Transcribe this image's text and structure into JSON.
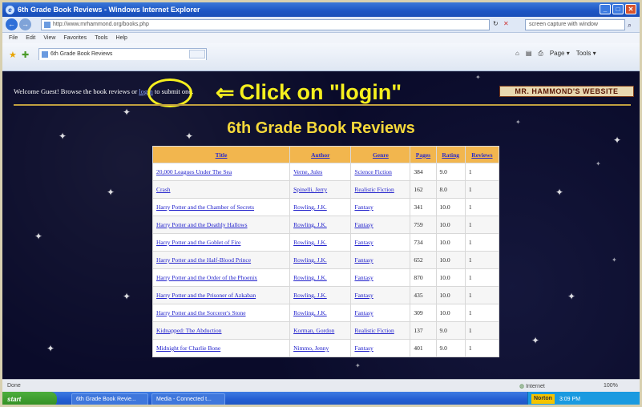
{
  "window": {
    "title": "6th Grade Book Reviews - Windows Internet Explorer",
    "min_label": "_",
    "max_label": "□",
    "close_label": "✕"
  },
  "address_bar": {
    "url": "http://www.mrhammond.org/books.php",
    "search_placeholder": "screen capture with window",
    "back_icon": "←",
    "forward_icon": "→",
    "refresh_icon": "↻",
    "stop_icon": "✕",
    "search_go_icon": "⌕"
  },
  "menu": [
    "File",
    "Edit",
    "View",
    "Favorites",
    "Tools",
    "Help"
  ],
  "tab": {
    "title": "6th Grade Book Reviews"
  },
  "command_bar": {
    "home_icon": "⌂",
    "feeds_icon": "▤",
    "print_icon": "⎙",
    "page_label": "Page ▾",
    "tools_label": "Tools ▾"
  },
  "page": {
    "welcome_prefix": "Welcome Guest! Browse the book reviews or",
    "login_link": "login",
    "welcome_suffix": "to submit one.",
    "callout_arrow": "⇐",
    "callout_text": "Click on \"login\"",
    "logo_text": "MR. HAMMOND'S WEBSITE",
    "heading": "6th Grade Book Reviews"
  },
  "table": {
    "columns": [
      "Title",
      "Author",
      "Genre",
      "Pages",
      "Rating",
      "Reviews"
    ],
    "rows": [
      [
        "20,000 Leagues Under The Sea",
        "Verne, Jules",
        "Science Fiction",
        "384",
        "9.0",
        "1"
      ],
      [
        "Crash",
        "Spinelli, Jerry",
        "Realistic Fiction",
        "162",
        "8.0",
        "1"
      ],
      [
        "Harry Potter and the Chamber of Secrets",
        "Rowling, J.K.",
        "Fantasy",
        "341",
        "10.0",
        "1"
      ],
      [
        "Harry Potter and the Deathly Hallows",
        "Rowling, J.K.",
        "Fantasy",
        "759",
        "10.0",
        "1"
      ],
      [
        "Harry Potter and the Goblet of Fire",
        "Rowling, J.K.",
        "Fantasy",
        "734",
        "10.0",
        "1"
      ],
      [
        "Harry Potter and the Half-Blood Prince",
        "Rowling, J.K.",
        "Fantasy",
        "652",
        "10.0",
        "1"
      ],
      [
        "Harry Potter and the Order of the Phoenix",
        "Rowling, J.K.",
        "Fantasy",
        "870",
        "10.0",
        "1"
      ],
      [
        "Harry Potter and the Prisoner of Azkaban",
        "Rowling, J.K.",
        "Fantasy",
        "435",
        "10.0",
        "1"
      ],
      [
        "Harry Potter and the Sorcerer's Stone",
        "Rowling, J.K.",
        "Fantasy",
        "309",
        "10.0",
        "1"
      ],
      [
        "Kidnapped: The Abduction",
        "Korman, Gordon",
        "Realistic Fiction",
        "137",
        "9.0",
        "1"
      ],
      [
        "Midnight for Charlie Bone",
        "Nimmo, Jenny",
        "Fantasy",
        "401",
        "9.0",
        "1"
      ]
    ]
  },
  "status_bar": {
    "left": "Done",
    "zone": "Internet",
    "zoom": "100%"
  },
  "taskbar": {
    "start": "start",
    "buttons": [
      "6th Grade Book Revie...",
      "Media - Connected t..."
    ],
    "tray_norton": "Norton",
    "clock": "3:09 PM"
  },
  "colors": {
    "heading": "#f5d83a",
    "callout": "#f5ef1e",
    "table_header": "#f2b64e",
    "background": "#0a0b2a"
  }
}
